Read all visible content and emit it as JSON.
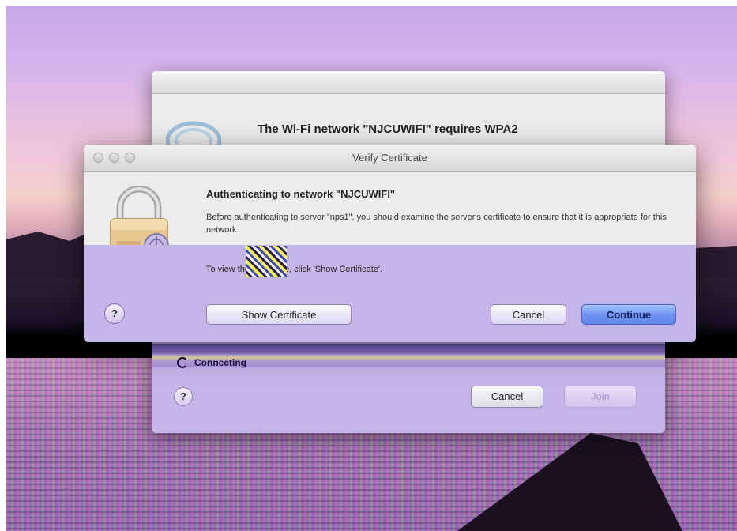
{
  "background_window": {
    "heading": "The Wi-Fi network \"NJCUWIFI\" requires WPA2",
    "status_text": "Connecting",
    "help_label": "?",
    "cancel_label": "Cancel",
    "join_label": "Join"
  },
  "dialog": {
    "title": "Verify Certificate",
    "heading": "Authenticating to network \"NJCUWIFI\"",
    "body": "Before authenticating to server \"nps1\", you should examine the server's certificate to ensure that it is appropriate for this network.",
    "view_hint": "To view the certificate, click 'Show Certificate'.",
    "help_label": "?",
    "show_certificate_label": "Show Certificate",
    "cancel_label": "Cancel",
    "continue_label": "Continue"
  },
  "colors": {
    "default_button": "#6f94f0",
    "dialog_background": "#ececec"
  }
}
